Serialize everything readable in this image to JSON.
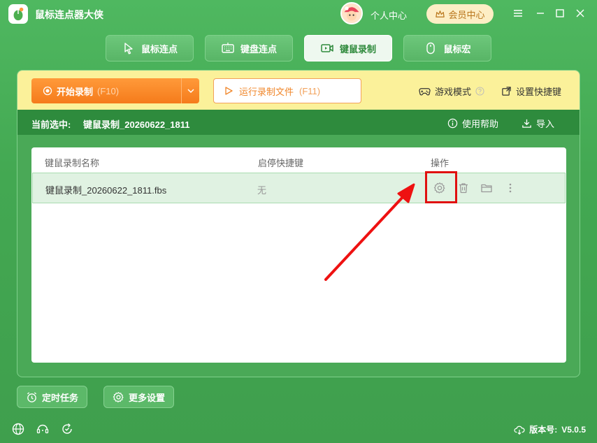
{
  "app": {
    "title": "鼠标连点器大侠"
  },
  "header": {
    "personal_center": "个人中心",
    "vip_center": "会员中心"
  },
  "tabs": [
    {
      "label": "鼠标连点",
      "icon": "cursor-icon"
    },
    {
      "label": "键盘连点",
      "icon": "keyboard-icon"
    },
    {
      "label": "键鼠录制",
      "icon": "video-record-icon",
      "active": true
    },
    {
      "label": "鼠标宏",
      "icon": "mouse-icon"
    }
  ],
  "toolbar": {
    "record_label": "开始录制",
    "record_key": "(F10)",
    "run_label": "运行录制文件",
    "run_key": "(F11)",
    "game_mode": "游戏模式",
    "set_shortcut": "设置快捷键"
  },
  "selection": {
    "label": "当前选中:",
    "value": "键鼠录制_20260622_1811",
    "help": "使用帮助",
    "import": "导入"
  },
  "table": {
    "headers": [
      "键鼠录制名称",
      "启停快捷键",
      "操作"
    ],
    "rows": [
      {
        "name": "键鼠录制_20260622_1811.fbs",
        "shortcut": "无"
      }
    ]
  },
  "bottom": {
    "timed_task": "定时任务",
    "more_settings": "更多设置"
  },
  "footer": {
    "version_label": "版本号:",
    "version": "V5.0.5"
  },
  "colors": {
    "accent_green": "#43a852",
    "accent_orange": "#f57b1b",
    "highlight_red": "#e01010"
  }
}
